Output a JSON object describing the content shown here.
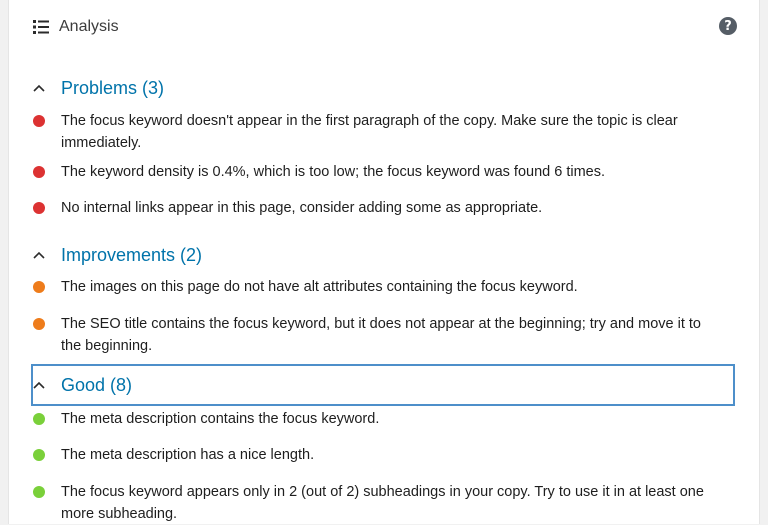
{
  "header": {
    "title": "Analysis",
    "help_label": "?",
    "list_icon": "list-icon",
    "help_icon": "help-icon"
  },
  "colors": {
    "red": "#dc3232",
    "orange": "#ee7c1b",
    "green": "#7ad03a",
    "link": "#0073aa"
  },
  "sections": [
    {
      "title": "Problems (3)",
      "items": [
        "The focus keyword doesn't appear in the first paragraph of the copy. Make sure the topic is clear immediately.",
        "The keyword density is 0.4%, which is too low; the focus keyword was found 6 times.",
        "No internal links appear in this page, consider adding some as appropriate."
      ]
    },
    {
      "title": "Improvements (2)",
      "items": [
        "The images on this page do not have alt attributes containing the focus keyword.",
        "The SEO title contains the focus keyword, but it does not appear at the beginning; try and move it to the beginning."
      ]
    },
    {
      "title": "Good (8)",
      "items": [
        "The meta description contains the focus keyword.",
        "The meta description has a nice length.",
        "The focus keyword appears only in 2 (out of 2) subheadings in your copy. Try to use it in at least one more subheading."
      ]
    }
  ]
}
